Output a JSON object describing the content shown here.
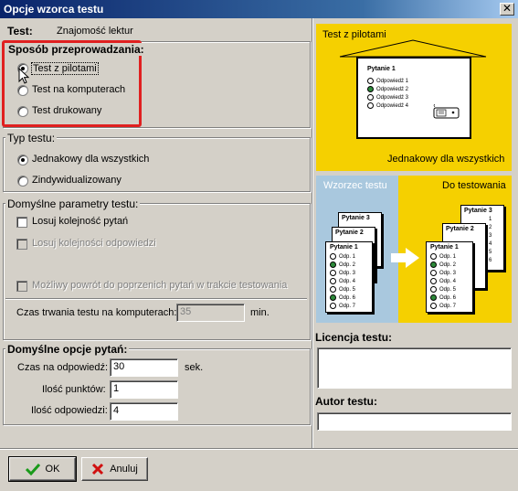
{
  "window": {
    "title": "Opcje wzorca testu",
    "close_symbol": "✕"
  },
  "test": {
    "label": "Test:",
    "name": "Znajomość lektur"
  },
  "mode": {
    "title": "Sposób przeprowadzania:",
    "options": [
      {
        "label": "Test z pilotami",
        "checked": true
      },
      {
        "label": "Test na komputerach",
        "checked": false
      },
      {
        "label": "Test drukowany",
        "checked": false
      }
    ]
  },
  "type": {
    "title": "Typ testu:",
    "options": [
      {
        "label": "Jednakowy dla wszystkich",
        "checked": true
      },
      {
        "label": "Zindywidualizowany",
        "checked": false
      }
    ]
  },
  "params": {
    "title": "Domyślne parametry testu:",
    "shuffle_questions": "Losuj kolejność pytań",
    "shuffle_answers": "Losuj kolejności odpowiedzi",
    "allow_back": "Możliwy powrót do poprzenich pytań w trakcie testowania",
    "duration_label": "Czas trwania testu na komputerach:",
    "duration_value": "35",
    "duration_unit": "min."
  },
  "question_opts": {
    "title": "Domyślne opcje pytań:",
    "time_label": "Czas na odpowiedź:",
    "time_value": "30",
    "time_unit": "sek.",
    "points_label": "Ilość punktów:",
    "points_value": "1",
    "answers_label": "Ilość odpowiedzi:",
    "answers_value": "4"
  },
  "preview_top": {
    "title": "Test z pilotami",
    "slide_question": "Pytanie 1",
    "slide_answers": [
      "Odpowiedź 1",
      "Odpowiedź 2",
      "Odpowiedź 3",
      "Odpowiedź 4"
    ],
    "caption": "Jednakowy dla wszystkich"
  },
  "preview_bottom": {
    "left_title": "Wzorzec testu",
    "right_title": "Do testowania",
    "card_q1": "Pytanie 1",
    "card_q2": "Pytanie 2",
    "card_q3": "Pytanie 3",
    "card_answers": [
      "Odp. 1",
      "Odp. 2",
      "Odp. 3",
      "Odp. 4",
      "Odp. 5",
      "Odp. 6",
      "Odp. 7"
    ],
    "back_numbers": [
      "1",
      "2",
      "3",
      "4",
      "5",
      "6",
      "7"
    ]
  },
  "license": {
    "label": "Licencja testu:",
    "value": ""
  },
  "author": {
    "label": "Autor testu:",
    "value": ""
  },
  "buttons": {
    "ok": "OK",
    "cancel": "Anuluj"
  },
  "colors": {
    "accent_yellow": "#f5d000",
    "accent_blue": "#a9c8de",
    "highlight_red": "#e02020",
    "answer_green": "#2d8a3a"
  }
}
